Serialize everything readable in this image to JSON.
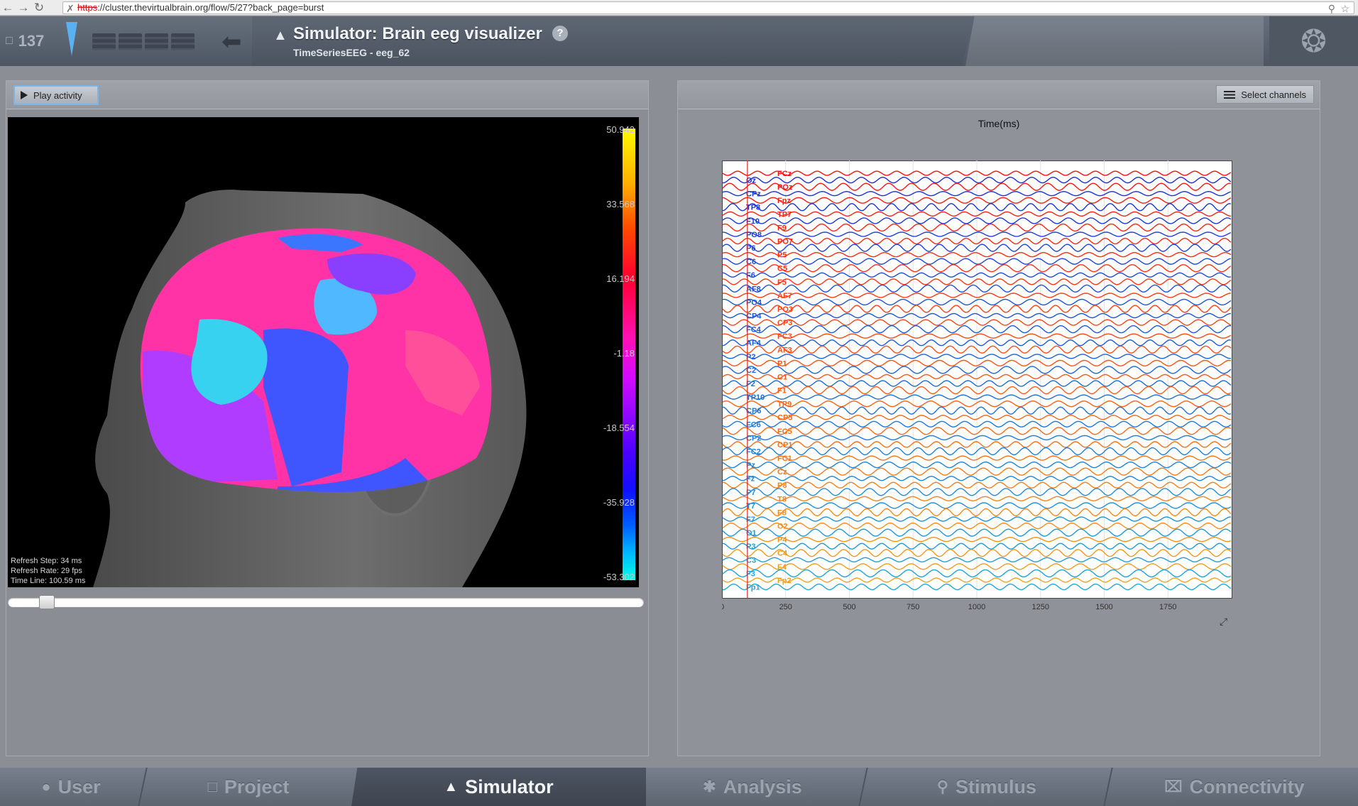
{
  "browser": {
    "url_secure": "https",
    "url_rest": "://cluster.thevirtualbrain.org/flow/5/27?back_page=burst"
  },
  "header": {
    "counter": "137",
    "title": "Simulator: Brain eeg visualizer",
    "subtitle": "TimeSeriesEEG - eeg_62",
    "help": "?"
  },
  "left_panel": {
    "play_label": "Play activity",
    "info": [
      "Refresh Step: 34 ms",
      "Refresh Rate: 29 fps",
      "Time Line: 100.59 ms"
    ],
    "colorbar_labels": [
      "50.942",
      "33.568",
      "16.194",
      "-1.18",
      "-18.554",
      "-35.928",
      "-53.302"
    ],
    "time_slider_fraction": 0.05
  },
  "right_panel": {
    "select_channels_label": "Select channels"
  },
  "chart_data": {
    "type": "line",
    "title": "Time(ms)",
    "xlim": [
      0,
      2000
    ],
    "x_ticks": [
      "0",
      "250",
      "500",
      "750",
      "1000",
      "1250",
      "1500",
      "1750"
    ],
    "cursor_time_ms": 100,
    "channels_left": [
      "Oz",
      "CPz",
      "TP8",
      "F10",
      "PO8",
      "P6",
      "C6",
      "F6",
      "AF8",
      "PO4",
      "CP4",
      "FC4",
      "AF4",
      "P2",
      "C2",
      "F2",
      "TP10",
      "CP6",
      "FC6",
      "CP2",
      "FC2",
      "Pz",
      "Fz",
      "P7",
      "T7",
      "F7",
      "O1",
      "P3",
      "C3",
      "F3",
      "Fp1"
    ],
    "channels_right": [
      "FCz",
      "POz",
      "Fpz",
      "TP7",
      "F9",
      "PO7",
      "P5",
      "C5",
      "F5",
      "AF7",
      "PO3",
      "CP3",
      "FC3",
      "AF3",
      "P1",
      "C1",
      "F1",
      "TP9",
      "CP5",
      "FC5",
      "CP1",
      "FC1",
      "Cz",
      "P8",
      "T8",
      "F8",
      "O2",
      "P4",
      "C4",
      "F4",
      "Fp2"
    ],
    "colors": {
      "left_top": "#1c2fd8",
      "left_bottom": "#1ea8d8",
      "right_top": "#ff1010",
      "right_bottom": "#f2a21a"
    }
  },
  "bottom_nav": {
    "items": [
      {
        "label": "User",
        "icon": "user-icon"
      },
      {
        "label": "Project",
        "icon": "document-icon"
      },
      {
        "label": "Simulator",
        "icon": "rocket-icon"
      },
      {
        "label": "Analysis",
        "icon": "gear-icon"
      },
      {
        "label": "Stimulus",
        "icon": "pin-icon"
      },
      {
        "label": "Connectivity",
        "icon": "network-icon"
      }
    ]
  }
}
